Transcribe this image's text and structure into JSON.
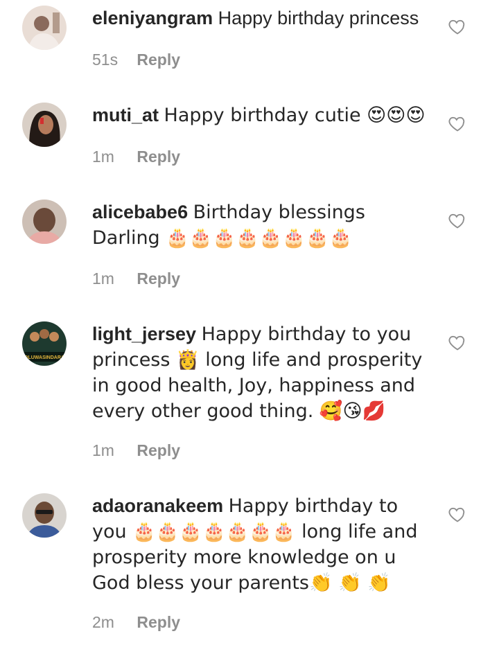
{
  "comments": [
    {
      "username": "eleniyangram",
      "text": "Happy birthday princess",
      "time": "51s",
      "reply_label": "Reply",
      "avatar_colors": [
        "#b39b8c",
        "#e8dbd2"
      ]
    },
    {
      "username": "muti_at",
      "text": "Happy birthday cutie 😍😍😍",
      "time": "1m",
      "reply_label": "Reply",
      "avatar_colors": [
        "#2b211d",
        "#c98f6f"
      ]
    },
    {
      "username": "alicebabe6",
      "text": "Birthday blessings Darling 🎂🎂🎂🎂🎂🎂🎂🎂",
      "time": "1m",
      "reply_label": "Reply",
      "avatar_colors": [
        "#6a4a3a",
        "#d7c3b6"
      ]
    },
    {
      "username": "light_jersey",
      "text": "Happy birthday to you princess 👸 long life and prosperity in good health, Joy, happiness and every other good thing. 🥰😘💋",
      "time": "1m",
      "reply_label": "Reply",
      "avatar_colors": [
        "#1e3a2f",
        "#e0b43c"
      ],
      "avatar_text": "OLUWASINDARA"
    },
    {
      "username": "adaoranakeem",
      "text": "Happy birthday to you 🎂🎂🎂🎂🎂🎂🎂 long life and prosperity more knowledge on u God bless your parents👏 👏 👏",
      "time": "2m",
      "reply_label": "Reply",
      "avatar_colors": [
        "#3b3f4a",
        "#c7a48e"
      ]
    }
  ]
}
